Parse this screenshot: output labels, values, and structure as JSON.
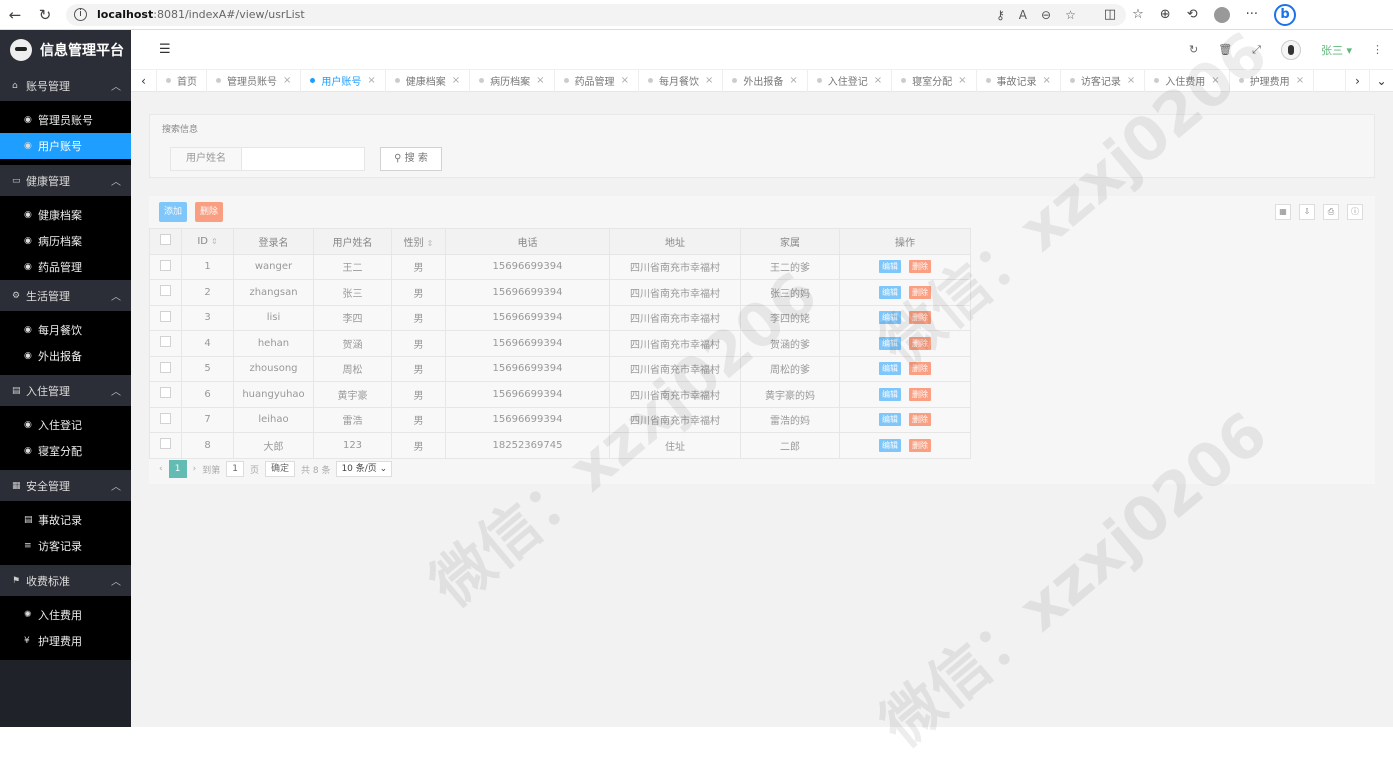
{
  "browser": {
    "url_host": "localhost",
    "url_path": ":8081/indexA#/view/usrList"
  },
  "sidebar": {
    "title": "信息管理平台",
    "groups": [
      {
        "label": "账号管理",
        "items": [
          {
            "label": "管理员账号"
          },
          {
            "label": "用户账号"
          }
        ]
      },
      {
        "label": "健康管理",
        "items": [
          {
            "label": "健康档案"
          },
          {
            "label": "病历档案"
          },
          {
            "label": "药品管理"
          }
        ]
      },
      {
        "label": "生活管理",
        "items": [
          {
            "label": "每月餐饮"
          },
          {
            "label": "外出报备"
          }
        ]
      },
      {
        "label": "入住管理",
        "items": [
          {
            "label": "入住登记"
          },
          {
            "label": "寝室分配"
          }
        ]
      },
      {
        "label": "安全管理",
        "items": [
          {
            "label": "事故记录"
          },
          {
            "label": "访客记录"
          }
        ]
      },
      {
        "label": "收费标准",
        "items": [
          {
            "label": "入住费用"
          },
          {
            "label": "护理费用"
          }
        ]
      }
    ]
  },
  "topbar": {
    "username": "张三"
  },
  "tabs": [
    {
      "label": "首页",
      "closable": false
    },
    {
      "label": "管理员账号"
    },
    {
      "label": "用户账号",
      "active": true
    },
    {
      "label": "健康档案"
    },
    {
      "label": "病历档案"
    },
    {
      "label": "药品管理"
    },
    {
      "label": "每月餐饮"
    },
    {
      "label": "外出报备"
    },
    {
      "label": "入住登记"
    },
    {
      "label": "寝室分配"
    },
    {
      "label": "事故记录"
    },
    {
      "label": "访客记录"
    },
    {
      "label": "入住费用"
    },
    {
      "label": "护理费用"
    }
  ],
  "search": {
    "legend": "搜索信息",
    "field_label": "用户姓名",
    "field_value": "",
    "button": "搜 索"
  },
  "toolbar": {
    "add": "添加",
    "delete": "删除"
  },
  "table": {
    "headers": [
      "ID",
      "登录名",
      "用户姓名",
      "性别",
      "电话",
      "地址",
      "家属",
      "操作"
    ],
    "edit_label": "编辑",
    "delete_label": "删除",
    "rows": [
      [
        "1",
        "wanger",
        "王二",
        "男",
        "15696699394",
        "四川省南充市幸福村",
        "王二的爹"
      ],
      [
        "2",
        "zhangsan",
        "张三",
        "男",
        "15696699394",
        "四川省南充市幸福村",
        "张三的妈"
      ],
      [
        "3",
        "lisi",
        "李四",
        "男",
        "15696699394",
        "四川省南充市幸福村",
        "李四的姥"
      ],
      [
        "4",
        "hehan",
        "贺涵",
        "男",
        "15696699394",
        "四川省南充市幸福村",
        "贺涵的爹"
      ],
      [
        "5",
        "zhousong",
        "周松",
        "男",
        "15696699394",
        "四川省南充市幸福村",
        "周松的爹"
      ],
      [
        "6",
        "huangyuhao",
        "黄宇豪",
        "男",
        "15696699394",
        "四川省南充市幸福村",
        "黄宇豪的妈"
      ],
      [
        "7",
        "leihao",
        "雷浩",
        "男",
        "15696699394",
        "四川省南充市幸福村",
        "雷浩的妈"
      ],
      [
        "8",
        "大郎",
        "123",
        "男",
        "18252369745",
        "住址",
        "二郎"
      ]
    ]
  },
  "pager": {
    "current": "1",
    "goto_label": "到第",
    "goto_value": "1",
    "page_unit": "页",
    "confirm": "确定",
    "total": "共 8 条",
    "page_size": "10 条/页"
  },
  "watermark": "微信：xzxj0206"
}
